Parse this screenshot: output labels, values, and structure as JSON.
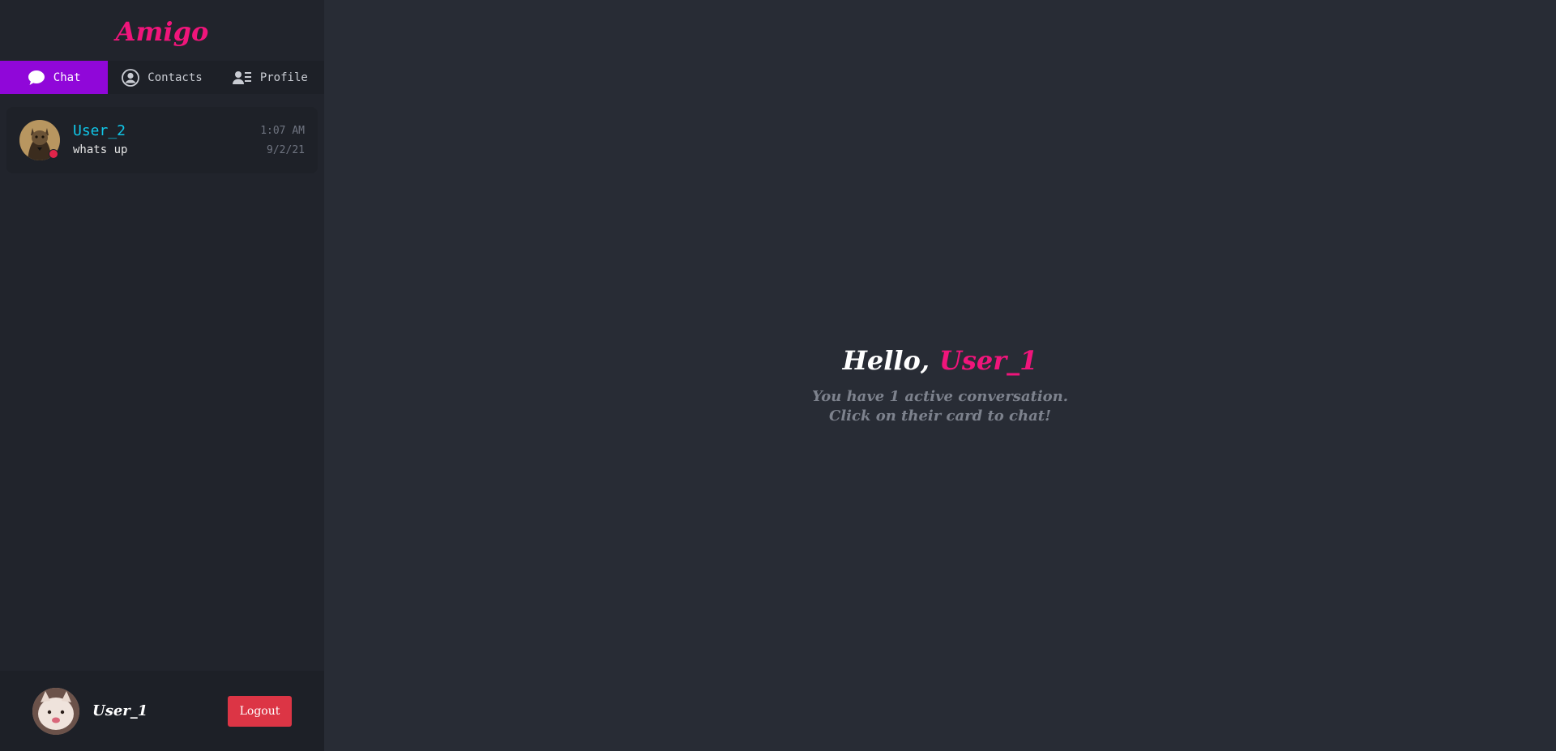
{
  "sidebar": {
    "brand": "Amigo",
    "tabs": [
      {
        "label": "Chat",
        "icon": "chat-bubble-icon",
        "active": true
      },
      {
        "label": "Contacts",
        "icon": "user-circle-icon",
        "active": false
      },
      {
        "label": "Profile",
        "icon": "profile-card-icon",
        "active": false
      }
    ],
    "conversations": [
      {
        "name": "User_2",
        "last_message": "whats up",
        "time": "1:07 AM",
        "date": "9/2/21",
        "status_color": "#e0244a"
      }
    ],
    "footer": {
      "username": "User_1",
      "logout_label": "Logout"
    }
  },
  "main": {
    "greeting": "Hello,",
    "username": "User_1",
    "line1": "You have 1 active conversation.",
    "line2": "Click on their card to chat!"
  },
  "colors": {
    "accent": "#f0157b",
    "active_tab": "#9007d9",
    "contact_name": "#10c6e8",
    "logout": "#dc3545"
  }
}
